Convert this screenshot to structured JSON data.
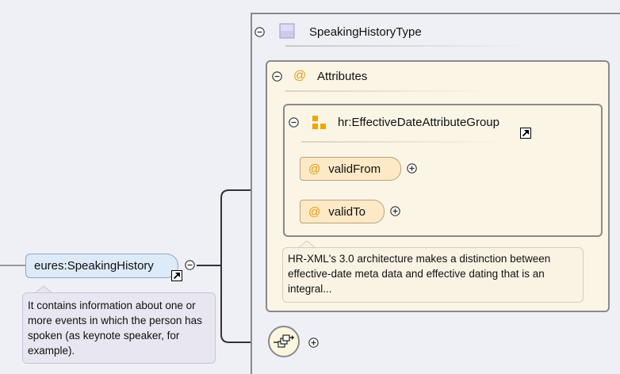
{
  "type": {
    "name": "SpeakingHistoryType"
  },
  "attributes": {
    "title": "Attributes",
    "group": {
      "name": "hr:EffectiveDateAttributeGroup",
      "items": [
        {
          "name": "validFrom"
        },
        {
          "name": "validTo"
        }
      ],
      "documentation": "HR-XML's 3.0 architecture makes a distinction between effective-date meta data and effective dating that is an integral..."
    }
  },
  "element": {
    "name": "eures:SpeakingHistory",
    "documentation": "It contains information about one or more events in which the person has spoken (as keynote speaker, for example)."
  },
  "icons": {
    "collapse": "collapse-icon",
    "expand": "expand-icon",
    "type": "complex-type-icon",
    "attribute": "attribute-icon",
    "group": "attribute-group-icon",
    "reference": "reference-arrow-icon",
    "sequence": "sequence-icon"
  },
  "colors": {
    "attribute_fill": "#fde9c6",
    "element_fill": "#ddeaf8",
    "attributes_bg": "#fbf5e6",
    "attribute_symbol": "#e59a10",
    "group_symbol": "#f0a500",
    "type_symbol": "#c9bde6"
  }
}
